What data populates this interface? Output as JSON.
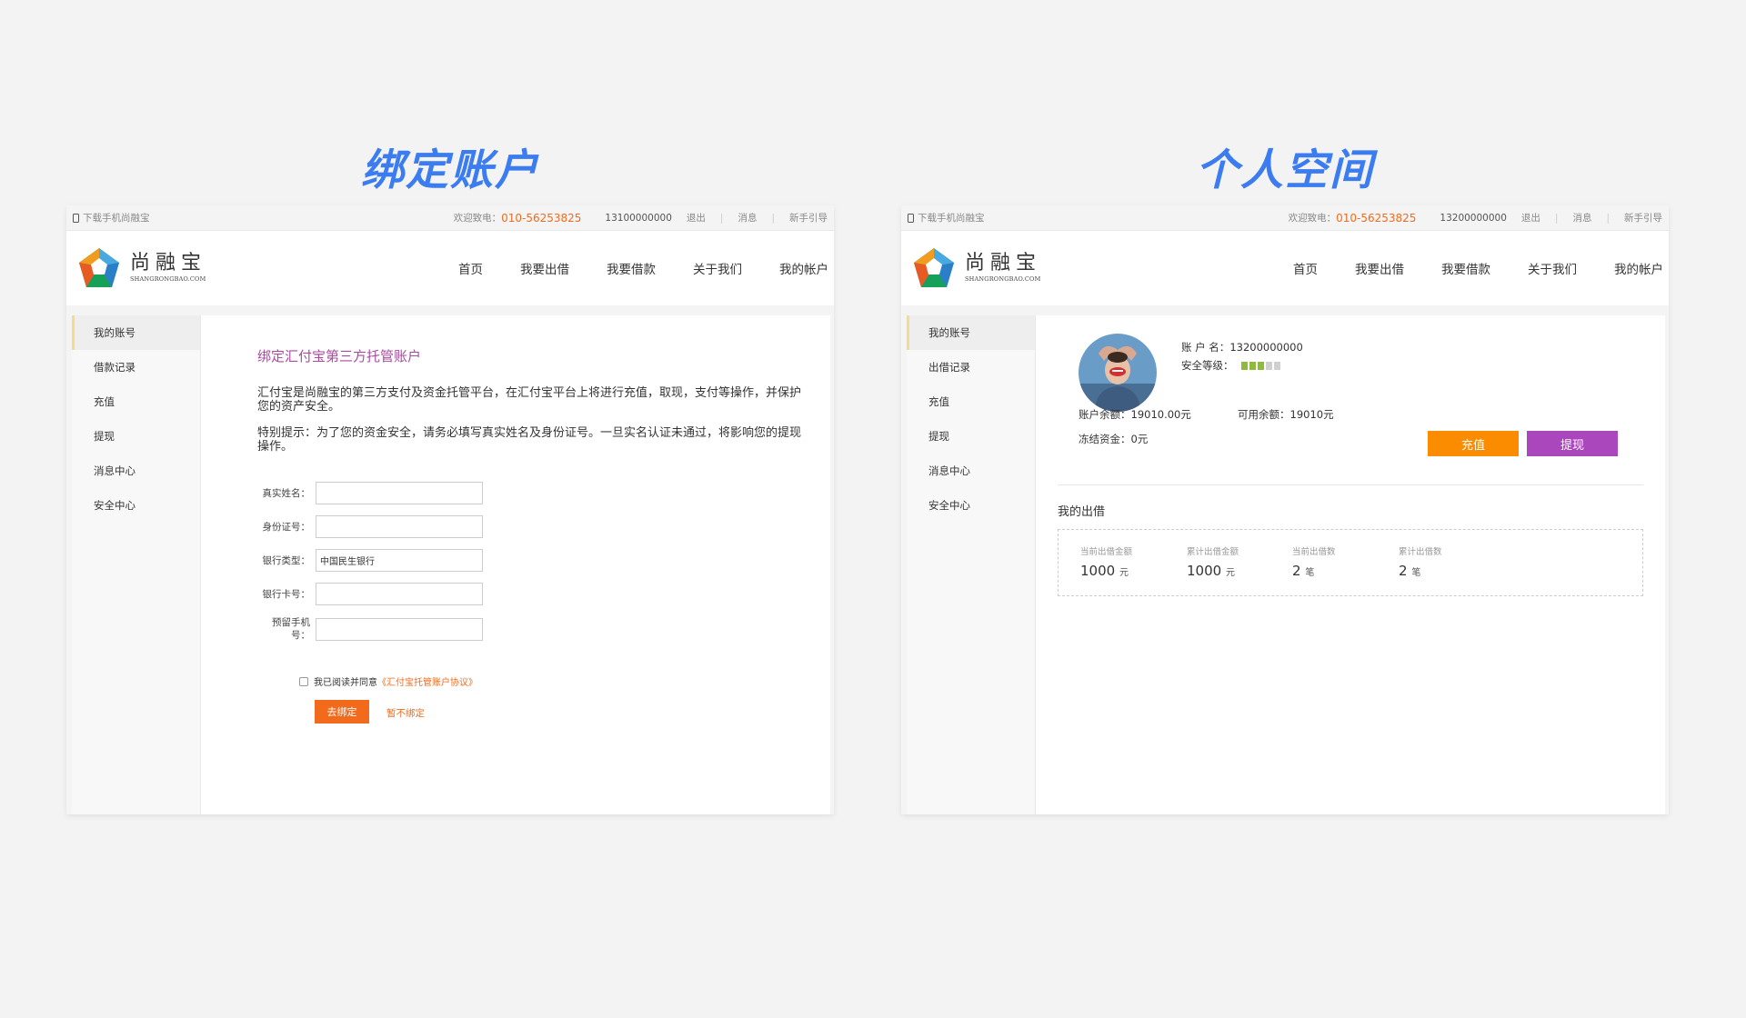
{
  "titles": {
    "left": "绑定账户",
    "right": "个人空间"
  },
  "colors": {
    "accent_blue": "#3b7cf0",
    "orange": "#f26b1d",
    "purple": "#a84c9f",
    "charge_orange": "#fb8c00",
    "withdraw_purple": "#ab47bc",
    "security_green": "#8dbb3c"
  },
  "left": {
    "topbar": {
      "download": "下载手机尚融宝",
      "welcome": "欢迎致电：",
      "hotline": "010-56253825",
      "account": "13100000000",
      "logout": "退出",
      "messages": "消息",
      "guide": "新手引导"
    },
    "logo": {
      "cn": "尚融宝",
      "en": "SHANGRONGBAO.COM"
    },
    "nav": [
      "首页",
      "我要出借",
      "我要借款",
      "关于我们",
      "我的帐户"
    ],
    "sidebar": [
      "我的账号",
      "借款记录",
      "充值",
      "提现",
      "消息中心",
      "安全中心"
    ],
    "content": {
      "title": "绑定汇付宝第三方托管账户",
      "para1": "汇付宝是尚融宝的第三方支付及资金托管平台，在汇付宝平台上将进行充值，取现，支付等操作，并保护您的资产安全。",
      "para2": "特别提示：为了您的资金安全，请务必填写真实姓名及身份证号。一旦实名认证未通过，将影响您的提现操作。",
      "form": {
        "name_label": "真实姓名：",
        "id_label": "身份证号：",
        "bank_type_label": "银行类型：",
        "bank_type_value": "中国民生银行",
        "card_label": "银行卡号：",
        "phone_label_1": "预留手机",
        "phone_label_2": "号："
      },
      "agree_text": "我已阅读并同意",
      "agree_link": "《汇付宝托管账户协议》",
      "bind_button": "去绑定",
      "skip_link": "暂不绑定"
    }
  },
  "right": {
    "topbar": {
      "download": "下载手机尚融宝",
      "welcome": "欢迎致电：",
      "hotline": "010-56253825",
      "account": "13200000000",
      "logout": "退出",
      "messages": "消息",
      "guide": "新手引导"
    },
    "logo": {
      "cn": "尚融宝",
      "en": "SHANGRONGBAO.COM"
    },
    "nav": [
      "首页",
      "我要出借",
      "我要借款",
      "关于我们",
      "我的帐户"
    ],
    "sidebar": [
      "我的账号",
      "出借记录",
      "充值",
      "提现",
      "消息中心",
      "安全中心"
    ],
    "content": {
      "account_name_label": "账 户 名：",
      "account_name": "13200000000",
      "security_label": "安全等级：",
      "security_level": 3,
      "security_max": 5,
      "balance_label": "账户余额：",
      "balance": "19010.00元",
      "available_label": "可用余额：",
      "available": "19010元",
      "frozen_label": "冻结资金：",
      "frozen": "0元",
      "charge_button": "充值",
      "withdraw_button": "提现",
      "my_lend_title": "我的出借",
      "stats": [
        {
          "label": "当前出借金额",
          "value": "1000",
          "unit": "元"
        },
        {
          "label": "累计出借金额",
          "value": "1000",
          "unit": "元"
        },
        {
          "label": "当前出借数",
          "value": "2",
          "unit": "笔"
        },
        {
          "label": "累计出借数",
          "value": "2",
          "unit": "笔"
        }
      ]
    }
  }
}
